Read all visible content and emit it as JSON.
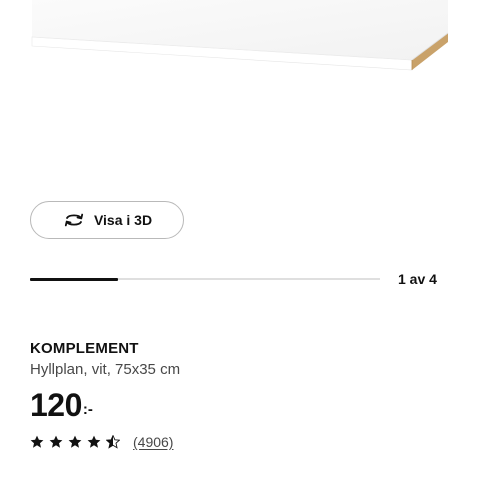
{
  "view3d": {
    "label": "Visa i 3D",
    "icon": "rotate-3d-icon"
  },
  "carousel": {
    "counter": "1 av 4",
    "progress": 0.25
  },
  "product": {
    "name": "KOMPLEMENT",
    "description": "Hyllplan, vit, 75x35 cm",
    "price_integer": "120",
    "price_suffix": ":-",
    "rating": 4.5,
    "rating_max": 5,
    "review_count": "(4906)"
  },
  "colors": {
    "text": "#111111",
    "secondary_text": "#484848",
    "shelf_white": "#ffffff",
    "shelf_edge": "#c9a26a",
    "track": "#dfdfdf"
  }
}
